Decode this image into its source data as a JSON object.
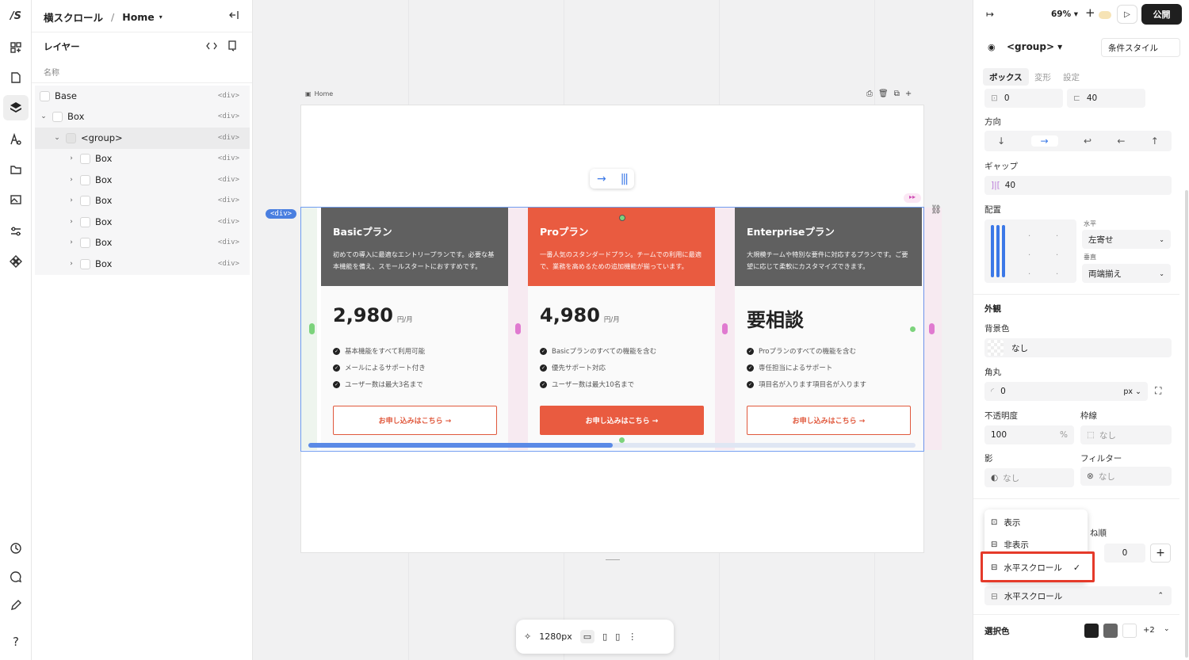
{
  "app": {
    "logo": "/S"
  },
  "breadcrumb": {
    "project": "横スクロール",
    "separator": "/",
    "page": "Home"
  },
  "layers": {
    "title": "レイヤー",
    "column": "名称",
    "rows": [
      {
        "label": "Base",
        "tag": "<div>"
      },
      {
        "label": "Box",
        "tag": "<div>"
      },
      {
        "label": "<group>",
        "tag": "<div>"
      },
      {
        "label": "Box",
        "tag": "<div>"
      },
      {
        "label": "Box",
        "tag": "<div>"
      },
      {
        "label": "Box",
        "tag": "<div>"
      },
      {
        "label": "Box",
        "tag": "<div>"
      },
      {
        "label": "Box",
        "tag": "<div>"
      },
      {
        "label": "Box",
        "tag": "<div>"
      }
    ]
  },
  "canvas": {
    "frame_label": "Home",
    "selection_tag": "<div>",
    "width_label": "1280px",
    "cards": [
      {
        "title": "Basicプラン",
        "desc": "初めての導入に最適なエントリープランです。必要な基本機能を備え、スモールスタートにおすすめです。",
        "price": "2,980",
        "unit": "円/月",
        "features": [
          "基本機能をすべて利用可能",
          "メールによるサポート付き",
          "ユーザー数は最大3名まで"
        ],
        "button": "お申し込みはこちら →",
        "head_color": "#606060"
      },
      {
        "title": "Proプラン",
        "desc": "一番人気のスタンダードプラン。チームでの利用に最適で、業務を高めるための追加機能が揃っています。",
        "price": "4,980",
        "unit": "円/月",
        "features": [
          "Basicプランのすべての機能を含む",
          "優先サポート対応",
          "ユーザー数は最大10名まで"
        ],
        "button": "お申し込みはこちら →",
        "head_color": "#e95b40"
      },
      {
        "title": "Enterpriseプラン",
        "desc": "大規模チームや特別な要件に対応するプランです。ご要望に応じて柔軟にカスタマイズできます。",
        "price": "要相談",
        "unit": "",
        "features": [
          "Proプランのすべての機能を含む",
          "専任担当によるサポート",
          "項目名が入ります項目名が入ります"
        ],
        "button": "お申し込みはこちら →",
        "head_color": "#606060"
      }
    ]
  },
  "toolbar": {
    "zoom": "69%",
    "publish": "公開"
  },
  "panel": {
    "element": "<group>",
    "cond_style": "条件スタイル",
    "tabs": [
      "ボックス",
      "変形",
      "設定"
    ],
    "top_vals": [
      "0",
      "40"
    ],
    "direction_label": "方向",
    "gap_label": "ギャップ",
    "gap_value": "40",
    "align_label": "配置",
    "horizontal_label": "水平",
    "horizontal_value": "左寄せ",
    "vertical_label": "垂直",
    "vertical_value": "両端揃え",
    "appearance": "外観",
    "bg_label": "背景色",
    "bg_value": "なし",
    "radius_label": "角丸",
    "radius_value": "0",
    "radius_unit": "px",
    "opacity_label": "不透明度",
    "opacity_value": "100",
    "opacity_unit": "%",
    "border_label": "枠線",
    "border_value": "なし",
    "shadow_label": "影",
    "shadow_value": "なし",
    "filter_label": "フィルター",
    "filter_value": "なし",
    "order_label": "ね順",
    "order_value": "0",
    "overflow_select": "水平スクロール",
    "selection_color": "選択色",
    "more_colors": "+2"
  },
  "menu": {
    "items": [
      "表示",
      "非表示",
      "水平スクロール"
    ]
  },
  "colors": {
    "accent": "#4a7fe0",
    "pro": "#e95b40",
    "dark_head": "#606060",
    "highlight_box": "#e53a2a"
  }
}
